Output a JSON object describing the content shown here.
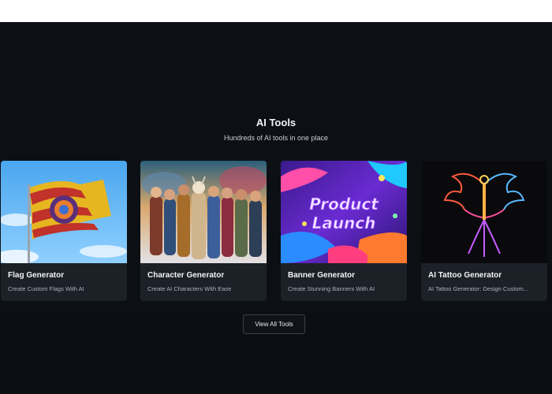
{
  "section": {
    "title": "AI Tools",
    "subtitle": "Hundreds of AI tools in one place"
  },
  "cards": [
    {
      "name": "Flag Generator",
      "description": "Create Custom Flags With AI",
      "image": "flag-image"
    },
    {
      "name": "Character Generator",
      "description": "Create AI Characters With Ease",
      "image": "characters-image"
    },
    {
      "name": "Banner Generator",
      "description": "Create Stunning Banners With AI",
      "image": "banner-image",
      "banner_text": [
        "Product",
        "Launch"
      ]
    },
    {
      "name": "AI Tattoo Generator",
      "description": "AI Tattoo Generator: Design Custom...",
      "image": "phoenix-image"
    }
  ],
  "view_all_label": "View All Tools",
  "colors": {
    "background": "#0b0e12",
    "card": "#1c2128",
    "accent_text": "#f1f3f5"
  }
}
